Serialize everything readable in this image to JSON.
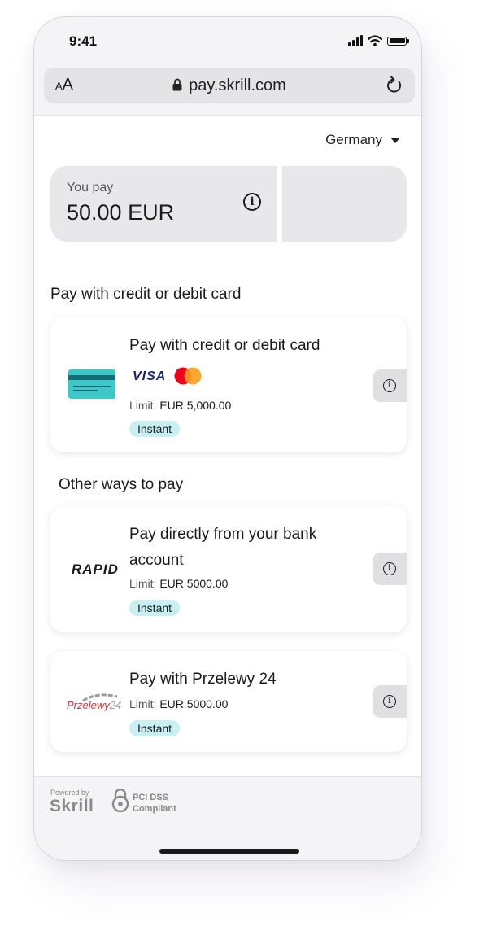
{
  "status_bar": {
    "time": "9:41"
  },
  "browser": {
    "text_size_small": "A",
    "text_size_large": "A",
    "url": "pay.skrill.com"
  },
  "country": {
    "selected": "Germany"
  },
  "payment": {
    "label": "You pay",
    "amount": "50.00 EUR"
  },
  "sections": {
    "card_title": "Pay with credit or debit card",
    "other_title": "Other ways to pay"
  },
  "methods": [
    {
      "title": "Pay with credit or debit card",
      "limit_label": "Limit:",
      "limit_value": "EUR 5,000.00",
      "badge": "Instant",
      "brands": [
        "VISA",
        "Mastercard"
      ]
    },
    {
      "title": "Pay directly from your bank account",
      "logo_text": "RAPID",
      "limit_label": "Limit:",
      "limit_value": "EUR 5000.00",
      "badge": "Instant"
    },
    {
      "title": "Pay with Przelewy 24",
      "logo_text": "Przelewy",
      "logo_suffix": "24",
      "limit_label": "Limit:",
      "limit_value": "EUR 5000.00",
      "badge": "Instant"
    }
  ],
  "footer": {
    "powered_by": "Powered by",
    "brand": "Skrill",
    "pci_line1": "PCI DSS",
    "pci_line2": "Compliant"
  },
  "colors": {
    "badge_bg": "#c8f0f2",
    "card_icon": "#3cc8c8",
    "mastercard_red": "#eb001b",
    "mastercard_orange": "#f79e1b",
    "visa_blue": "#1a1f71"
  }
}
